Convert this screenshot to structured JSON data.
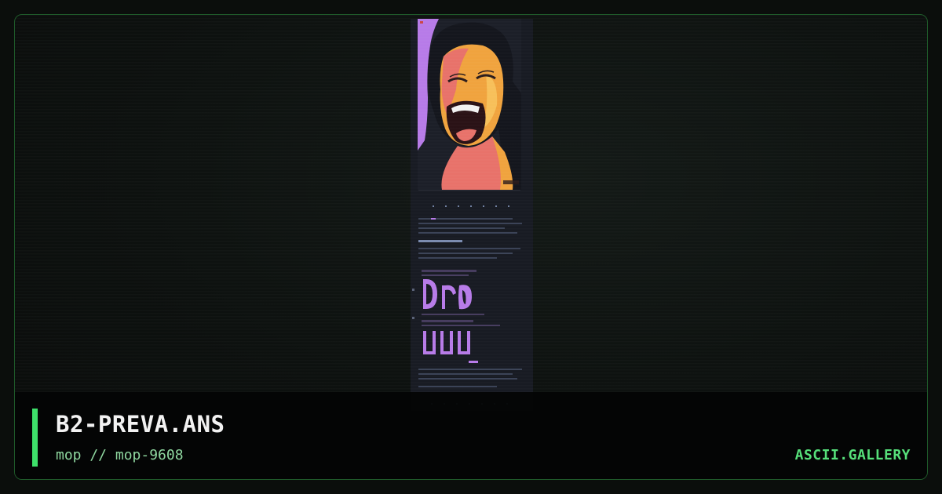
{
  "artwork": {
    "filename": "B2-PREVA.ANS",
    "byline": "mop // mop-9608"
  },
  "site": {
    "name": "ASCII.GALLERY"
  },
  "colors": {
    "accent": "#3ee06a",
    "brand": "#56e07a",
    "byline": "#8fd8a0",
    "border": "#1f5a2a"
  }
}
